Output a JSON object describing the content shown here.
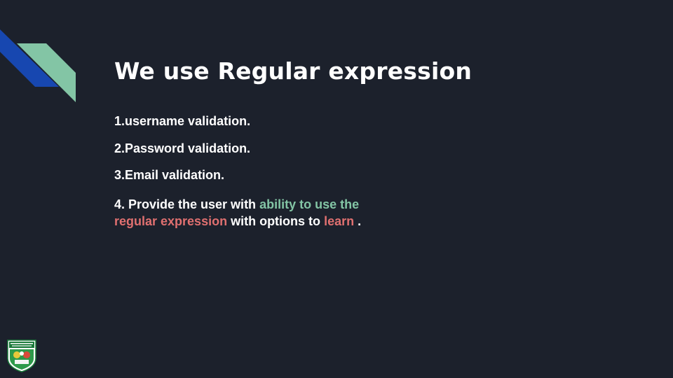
{
  "slide": {
    "title": "We use Regular expression",
    "items": [
      "1.username validation.",
      "2.Password validation.",
      "3.Email validation."
    ],
    "item4": {
      "prefix": "4. Provide the user with ",
      "highlight1": "ability to use the",
      "highlight2": "regular expression",
      "middle": " with options to ",
      "highlight3": "learn",
      "suffix": " ."
    }
  },
  "colors": {
    "background": "#1c212c",
    "text": "#ffffff",
    "accent_green": "#83c5a5",
    "accent_red": "#e07070",
    "accent_blue": "#1747b0"
  },
  "icons": {
    "corner_decoration": "diagonal-stripes-icon",
    "logo": "university-crest-logo"
  }
}
